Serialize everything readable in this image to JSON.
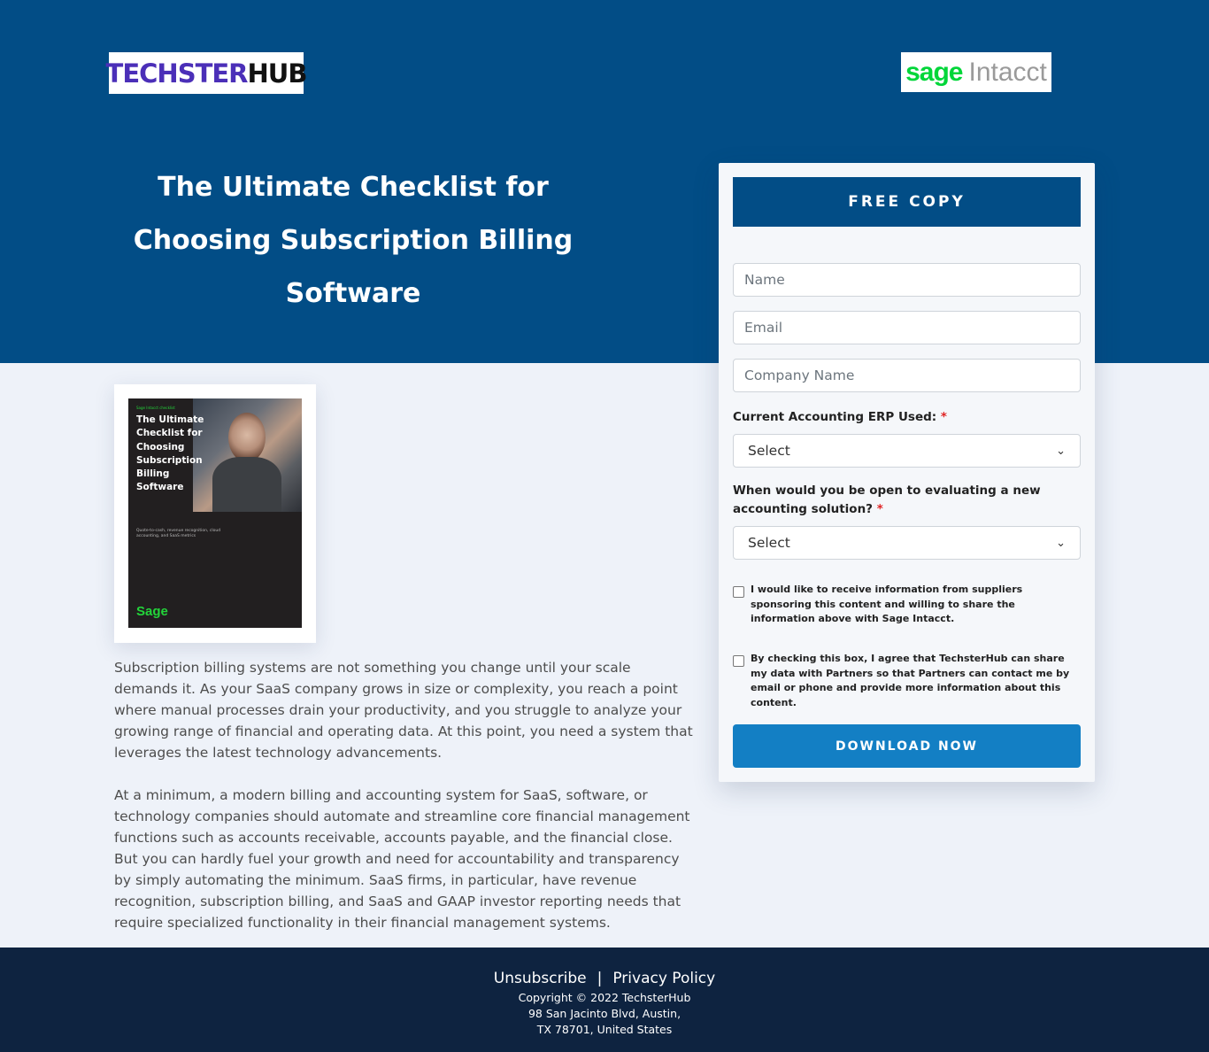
{
  "header": {
    "logo_left": {
      "part1": "TECHSTER",
      "part2": "HUB"
    },
    "logo_right": {
      "part1": "sage",
      "part2": "Intacct"
    },
    "title": "The Ultimate Checklist for Choosing Subscription Billing Software"
  },
  "book": {
    "kicker": "Sage Intacct checklist",
    "title": "The Ultimate Checklist for Choosing Subscription Billing Software",
    "subtitle": "Quote-to-cash, revenue recognition, cloud accounting, and SaaS metrics",
    "brand": "Sage"
  },
  "body": {
    "p1": "Subscription billing systems are not something you change until your scale demands it. As your SaaS company grows in size or complexity, you reach a point where manual processes drain your productivity, and you struggle to analyze your growing range of financial and operating data. At this point, you need a system that leverages the latest technology advancements.",
    "p2": "At a minimum, a modern billing and accounting system for SaaS, software, or technology companies should automate and streamline core financial management functions such as accounts receivable, accounts payable, and the financial close. But you can hardly fuel your growth and need for accountability and transparency by simply automating the minimum. SaaS firms, in particular, have revenue recognition, subscription billing, and SaaS and GAAP investor reporting needs that require specialized functionality in their financial management systems."
  },
  "form": {
    "heading": "FREE COPY",
    "name_placeholder": "Name",
    "email_placeholder": "Email",
    "company_placeholder": "Company Name",
    "erp_label": "Current Accounting ERP Used:",
    "erp_value": "Select",
    "when_label": "When would you be open to evaluating a new accounting solution?",
    "when_value": "Select",
    "required_mark": "*",
    "consent1": "I would like to receive information from suppliers sponsoring this content and willing to share the information above with Sage Intacct.",
    "consent2": "By checking this box, I agree that TechsterHub can share my data with Partners so that Partners can contact me by email or phone and provide more information about this content.",
    "submit": "DOWNLOAD NOW"
  },
  "footer": {
    "unsubscribe": "Unsubscribe",
    "separator": "|",
    "privacy": "Privacy Policy",
    "copyright": "Copyright © 2022 TechsterHub",
    "address1": "98 San Jacinto Blvd, Austin,",
    "address2": "TX 78701, United States"
  },
  "colors": {
    "hero": "#024d86",
    "button": "#137fc4",
    "footer": "#0e2340",
    "sage_green": "#00d639"
  },
  "icons": {
    "select_chevron": "chevron-down-icon"
  }
}
